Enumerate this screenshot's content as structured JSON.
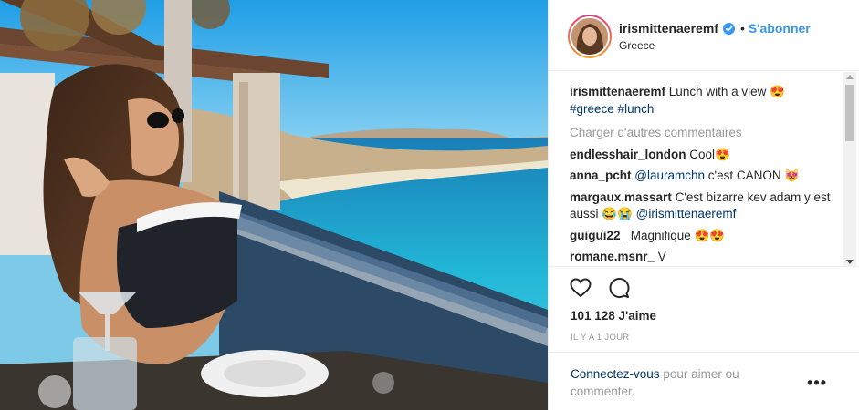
{
  "photo": {
    "description_icon": "photo"
  },
  "header": {
    "username": "irismittenaeremf",
    "verified_icon": "verified-badge-icon",
    "separator": "•",
    "follow_label": "S'abonner",
    "location": "Greece"
  },
  "caption": {
    "username": "irismittenaeremf",
    "text": " Lunch with a view 😍",
    "hashtag1": "#greece",
    "hashtag2": "#lunch"
  },
  "load_more": "Charger d'autres commentaires",
  "comments": [
    {
      "user": "endlesshair_london",
      "text": " Cool😍"
    },
    {
      "user": "anna_pcht",
      "mention": "@lauramchn",
      "text": " c'est CANON 😻"
    },
    {
      "user": "margaux.massart",
      "text": " C'est bizarre kev adam y est aussi 😂😭 ",
      "mention": "@irismittenaeremf"
    },
    {
      "user": "guigui22_",
      "text": " Magnifique 😍😍"
    },
    {
      "user": "romane.msnr_",
      "text": " V"
    }
  ],
  "actions": {
    "like_icon": "heart-icon",
    "comment_icon": "comment-icon"
  },
  "likes": "101 128 J'aime",
  "time": "IL Y A 1 JOUR",
  "footer": {
    "login_link": "Connectez-vous",
    "login_text": " pour aimer ou commenter.",
    "more": "•••"
  },
  "colors": {
    "link_blue": "#3897f0",
    "tag_blue": "#003569",
    "muted": "#999999",
    "text": "#262626",
    "border": "#efefef"
  }
}
